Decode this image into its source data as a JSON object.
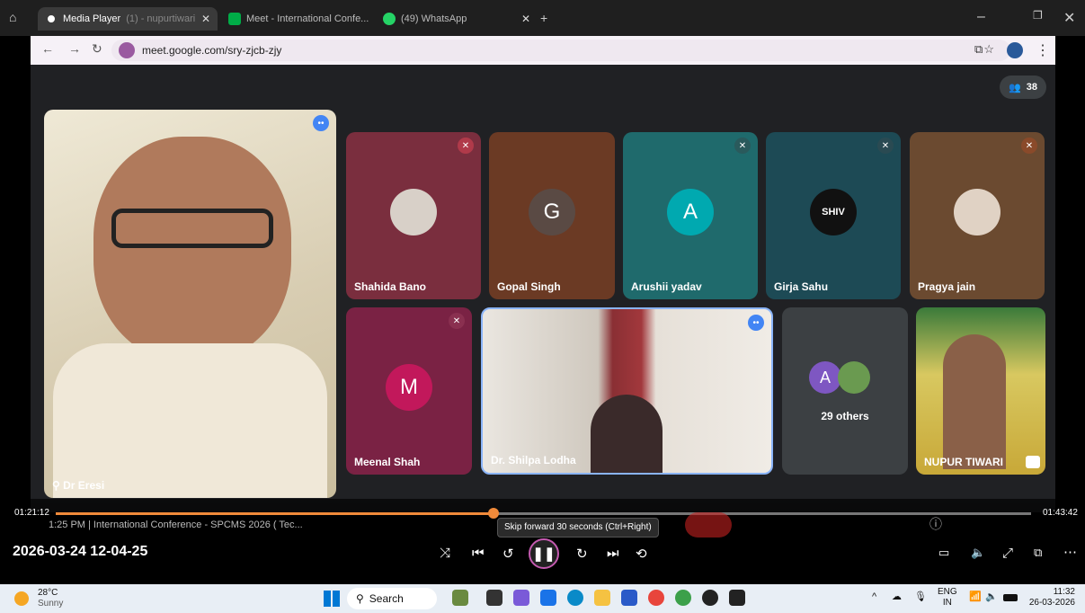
{
  "browser": {
    "tabs": [
      {
        "label": "Media Player",
        "behind": "(1) - nupurtiwari1503...",
        "active": true
      },
      {
        "label": "Meet - International Confe...",
        "active": false
      },
      {
        "label": "(49) WhatsApp",
        "active": false
      }
    ],
    "url": "meet.google.com/sry-zjcb-zjy"
  },
  "meet": {
    "participant_count": "38",
    "speaker": {
      "name": "Dr Eresi"
    },
    "tiles": [
      {
        "name": "Shahida Bano",
        "avatar": "",
        "color": "#7a2e3e"
      },
      {
        "name": "Gopal Singh",
        "avatar": "G",
        "color": "#6b3a24"
      },
      {
        "name": "Arushii yadav",
        "avatar": "A",
        "color": "#1f6a6c"
      },
      {
        "name": "Girja Sahu",
        "avatar": "SHIV",
        "color": "#1d4a55"
      },
      {
        "name": "Pragya jain",
        "avatar": "",
        "color": "#6b4a30"
      },
      {
        "name": "Meenal Shah",
        "avatar": "M",
        "color": "#7a2244"
      },
      {
        "name": "Dr. Shilpa Lodha",
        "avatar": "",
        "color": "#3a3a3a"
      },
      {
        "name": "NUPUR TIWARI",
        "avatar": "",
        "color": "#6a5a30"
      }
    ],
    "others": {
      "label": "29 others",
      "avatar": "A"
    },
    "meeting_info": "1:25 PM  |  International Conference - SPCMS 2026 ( Tec..."
  },
  "player": {
    "elapsed": "01:21:12",
    "total": "01:43:42",
    "progress": 0.449,
    "timestamp": "2026-03-24 12-04-25",
    "tooltip": "Skip forward 30 seconds (Ctrl+Right)"
  },
  "taskbar": {
    "weather_temp": "28°C",
    "weather_desc": "Sunny",
    "search": "Search",
    "lang": "ENG",
    "region": "IN",
    "time": "11:32",
    "date": "26-03-2026"
  }
}
